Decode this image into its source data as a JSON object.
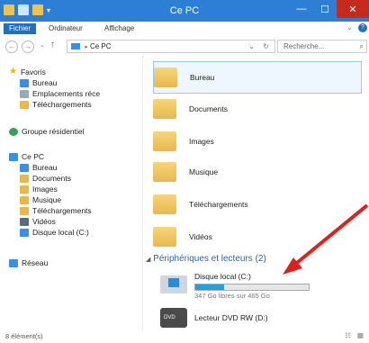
{
  "window": {
    "title": "Ce PC"
  },
  "ribbon": {
    "tabs": [
      "Fichier",
      "Ordinateur",
      "Affichage"
    ]
  },
  "address": {
    "path": "Ce PC",
    "search_placeholder": "Recherche..."
  },
  "sidebar": {
    "favorites_header": "Favoris",
    "favorites": [
      "Bureau",
      "Emplacements réce",
      "Téléchargements"
    ],
    "homegroup": "Groupe résidentiel",
    "pc_header": "Ce PC",
    "pc_items": [
      "Bureau",
      "Documents",
      "Images",
      "Musique",
      "Téléchargements",
      "Vidéos",
      "Disque local (C:)"
    ],
    "network": "Réseau"
  },
  "main": {
    "folders": [
      "Bureau",
      "Documents",
      "Images",
      "Musique",
      "Téléchargements",
      "Vidéos"
    ],
    "devices_header": "Périphériques et lecteurs (2)",
    "drives": [
      {
        "label": "Disque local (C:)",
        "space_text": "347 Go libres sur 465 Go",
        "used_fraction": 0.254
      },
      {
        "label": "Lecteur DVD RW (D:)"
      }
    ]
  },
  "status": {
    "items": "8 élément(s)"
  },
  "colors": {
    "title_bar": "#2d7fd6",
    "folder": "#e9b84d",
    "annotation_arrow": "#e0201c",
    "drive_fill": "#26a0da"
  }
}
